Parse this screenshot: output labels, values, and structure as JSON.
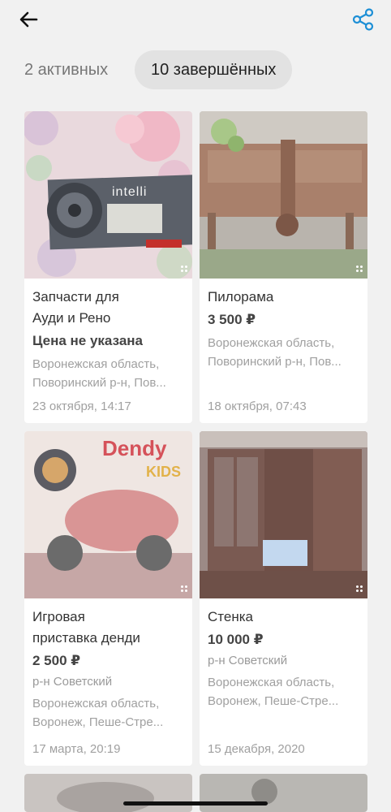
{
  "header": {
    "back_icon": "arrow-left-icon",
    "share_icon": "share-icon",
    "accent_color": "#1d8fd6"
  },
  "tabs": [
    {
      "label": "2 активных",
      "selected": false
    },
    {
      "label": "10 завершённых",
      "selected": true
    }
  ],
  "listings": [
    {
      "title_line1": "Запчасти для",
      "title_line2": "Ауди и Рено",
      "price": "Цена не указана",
      "district": "",
      "location_line1": "Воронежская область,",
      "location_line2": "Поворинский р-н, Пов...",
      "date": "23 октября, 14:17",
      "photo_text": "intelli"
    },
    {
      "title_line1": "Пилорама",
      "title_line2": "",
      "price": "3 500 ₽",
      "district": "",
      "location_line1": "Воронежская область,",
      "location_line2": "Поворинский р-н, Пов...",
      "date": "18 октября, 07:43"
    },
    {
      "title_line1": "Игровая",
      "title_line2": "приставка денди",
      "price": "2 500 ₽",
      "district": "р-н Советский",
      "location_line1": "Воронежская область,",
      "location_line2": "Воронеж, Пеше-Стре...",
      "date": "17 марта, 20:19",
      "photo_text": "Dendy",
      "photo_text2": "KIDS"
    },
    {
      "title_line1": "Стенка",
      "title_line2": "",
      "price": "10 000 ₽",
      "district": "р-н Советский",
      "location_line1": "Воронежская область,",
      "location_line2": "Воронеж, Пеше-Стре...",
      "date": "15 декабря, 2020"
    }
  ]
}
